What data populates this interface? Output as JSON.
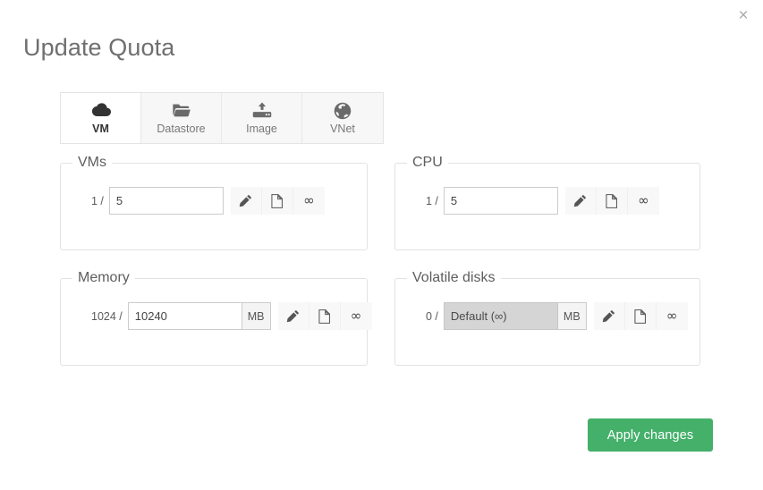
{
  "window": {
    "title": "Update Quota",
    "close_label": "×",
    "close_icon": "close-icon"
  },
  "tabs": [
    {
      "id": "vm",
      "label": "VM",
      "icon": "cloud-icon",
      "active": true
    },
    {
      "id": "datastore",
      "label": "Datastore",
      "icon": "folder-open-icon",
      "active": false
    },
    {
      "id": "image",
      "label": "Image",
      "icon": "hdd-upload-icon",
      "active": false
    },
    {
      "id": "vnet",
      "label": "VNet",
      "icon": "globe-icon",
      "active": false
    }
  ],
  "panels": [
    {
      "id": "vms",
      "legend": "VMs",
      "used_label": "1 /",
      "value": "5",
      "placeholder": "",
      "unit": "",
      "has_unit": false,
      "disabled": false
    },
    {
      "id": "cpu",
      "legend": "CPU",
      "used_label": "1 /",
      "value": "5",
      "placeholder": "",
      "unit": "",
      "has_unit": false,
      "disabled": false
    },
    {
      "id": "memory",
      "legend": "Memory",
      "used_label": "1024 /",
      "value": "10240",
      "placeholder": "",
      "unit": "MB",
      "has_unit": true,
      "disabled": false
    },
    {
      "id": "volatile-disks",
      "legend": "Volatile disks",
      "used_label": "0 /",
      "value": "Default (∞)",
      "placeholder": "Default (∞)",
      "unit": "MB",
      "has_unit": true,
      "disabled": true
    }
  ],
  "row_actions": [
    {
      "id": "edit",
      "icon": "pencil-icon",
      "glyph": ""
    },
    {
      "id": "default",
      "icon": "document-icon",
      "glyph": ""
    },
    {
      "id": "unlimited",
      "icon": "infinity-icon",
      "glyph": "∞"
    }
  ],
  "footer": {
    "apply_label": "Apply changes"
  },
  "colors": {
    "accent": "#44b06a",
    "title": "#6f6f6f",
    "panel_border": "#e2e2e2",
    "tab_inactive_bg": "#f7f7f7",
    "tab_active_bg": "#ffffff",
    "disabled_input_bg": "#d5d5d5"
  }
}
